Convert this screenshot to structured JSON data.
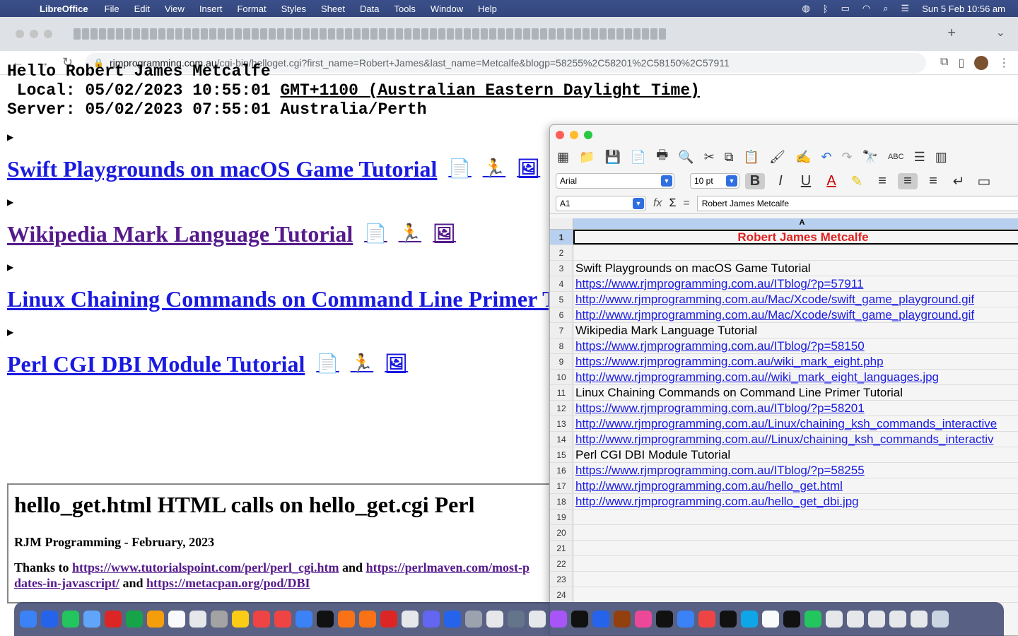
{
  "menubar": {
    "app": "LibreOffice",
    "items": [
      "File",
      "Edit",
      "View",
      "Insert",
      "Format",
      "Styles",
      "Sheet",
      "Data",
      "Tools",
      "Window",
      "Help"
    ],
    "clock": "Sun 5 Feb  10:56 am"
  },
  "browser": {
    "url_host": "rjmprogramming.com.au",
    "url_path": "/cgi-bin/helloget.cgi?first_name=Robert+James&last_name=Metcalfe&blogp=58255%2C58201%2C58150%2C57911"
  },
  "page": {
    "hello": "Hello Robert James Metcalfe",
    "local_label": " Local: 05/02/2023 10:55:01 ",
    "local_tz": "GMT+1100 (Australian Eastern Daylight Time)",
    "server": "Server: 05/02/2023 07:55:01 Australia/Perth",
    "tutorials": [
      {
        "title": "Swift Playgrounds on macOS Game Tutorial"
      },
      {
        "title": "Wikipedia Mark Language Tutorial"
      },
      {
        "title": "Linux Chaining Commands on Command Line Primer Tutorial"
      },
      {
        "title": "Perl CGI DBI Module Tutorial"
      }
    ],
    "box": {
      "heading": "hello_get.html HTML calls on hello_get.cgi Perl",
      "subheading": "RJM Programming - February, 2023",
      "thanks": "Thanks to ",
      "link1": "https://www.tutorialspoint.com/perl/perl_cgi.htm",
      "and1": " and ",
      "link2": "https://perlmaven.com/most-p",
      "link2b": "dates-in-javascript/",
      "and2": " and ",
      "link3": "https://metacpan.org/pod/DBI"
    }
  },
  "calc": {
    "font_name": "Arial",
    "font_size": "10 pt",
    "cell_ref": "A1",
    "formula_value": "Robert James Metcalfe",
    "column": "A",
    "rows": [
      {
        "n": "1",
        "v": "Robert James Metcalfe",
        "link": false
      },
      {
        "n": "2",
        "v": "",
        "link": false
      },
      {
        "n": "3",
        "v": "Swift Playgrounds on macOS Game Tutorial",
        "link": false
      },
      {
        "n": "4",
        "v": "https://www.rjmprogramming.com.au/ITblog/?p=57911",
        "link": true
      },
      {
        "n": "5",
        "v": "http://www.rjmprogramming.com.au/Mac/Xcode/swift_game_playground.gif",
        "link": true
      },
      {
        "n": "6",
        "v": "http://www.rjmprogramming.com.au/Mac/Xcode/swift_game_playground.gif",
        "link": true
      },
      {
        "n": "7",
        "v": "Wikipedia Mark Language Tutorial",
        "link": false
      },
      {
        "n": "8",
        "v": "https://www.rjmprogramming.com.au/ITblog/?p=58150",
        "link": true
      },
      {
        "n": "9",
        "v": "https://www.rjmprogramming.com.au/wiki_mark_eight.php",
        "link": true
      },
      {
        "n": "10",
        "v": "http://www.rjmprogramming.com.au//wiki_mark_eight_languages.jpg",
        "link": true
      },
      {
        "n": "11",
        "v": "Linux Chaining Commands on Command Line Primer Tutorial",
        "link": false
      },
      {
        "n": "12",
        "v": "https://www.rjmprogramming.com.au/ITblog/?p=58201",
        "link": true
      },
      {
        "n": "13",
        "v": "http://www.rjmprogramming.com.au/Linux/chaining_ksh_commands_interactive",
        "link": true
      },
      {
        "n": "14",
        "v": "http://www.rjmprogramming.com.au//Linux/chaining_ksh_commands_interactiv",
        "link": true
      },
      {
        "n": "15",
        "v": "Perl CGI DBI Module Tutorial",
        "link": false
      },
      {
        "n": "16",
        "v": "https://www.rjmprogramming.com.au/ITblog/?p=58255",
        "link": true
      },
      {
        "n": "17",
        "v": "http://www.rjmprogramming.com.au/hello_get.html",
        "link": true
      },
      {
        "n": "18",
        "v": "http://www.rjmprogramming.com.au/hello_get_dbi.jpg",
        "link": true
      },
      {
        "n": "19",
        "v": "",
        "link": false
      },
      {
        "n": "20",
        "v": "",
        "link": false
      },
      {
        "n": "21",
        "v": "",
        "link": false
      },
      {
        "n": "22",
        "v": "",
        "link": false
      },
      {
        "n": "23",
        "v": "",
        "link": false
      },
      {
        "n": "24",
        "v": "",
        "link": false
      }
    ]
  }
}
